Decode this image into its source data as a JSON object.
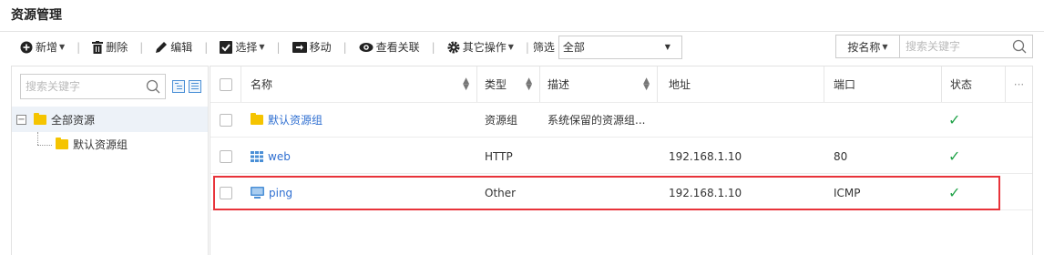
{
  "page": {
    "title": "资源管理"
  },
  "toolbar": {
    "add_label": "新增",
    "delete_label": "删除",
    "edit_label": "编辑",
    "select_label": "选择",
    "move_label": "移动",
    "view_assoc_label": "查看关联",
    "other_ops_label": "其它操作",
    "filter_label": "筛选",
    "filter_value": "全部",
    "sort_value": "按名称",
    "search_placeholder": "搜索关键字"
  },
  "tree": {
    "search_placeholder": "搜索关键字",
    "root": {
      "label": "全部资源",
      "toggle": "−"
    },
    "children": [
      {
        "label": "默认资源组"
      }
    ]
  },
  "table": {
    "headers": {
      "name": "名称",
      "type": "类型",
      "desc": "描述",
      "address": "地址",
      "port": "端口",
      "status": "状态",
      "more": "···"
    },
    "rows": [
      {
        "name": "默认资源组",
        "icon": "folder-icon",
        "type": "资源组",
        "desc": "系统保留的资源组...",
        "address": "",
        "port": "",
        "status": "ok"
      },
      {
        "name": "web",
        "icon": "grid-app-icon",
        "type": "HTTP",
        "desc": "",
        "address": "192.168.1.10",
        "port": "80",
        "status": "ok"
      },
      {
        "name": "ping",
        "icon": "monitor-icon",
        "type": "Other",
        "desc": "",
        "address": "192.168.1.10",
        "port": "ICMP",
        "status": "ok"
      }
    ]
  },
  "colors": {
    "link": "#2f6fd1",
    "status_ok": "#22a34a",
    "highlight": "#e8333a",
    "folder": "#f5c400"
  }
}
